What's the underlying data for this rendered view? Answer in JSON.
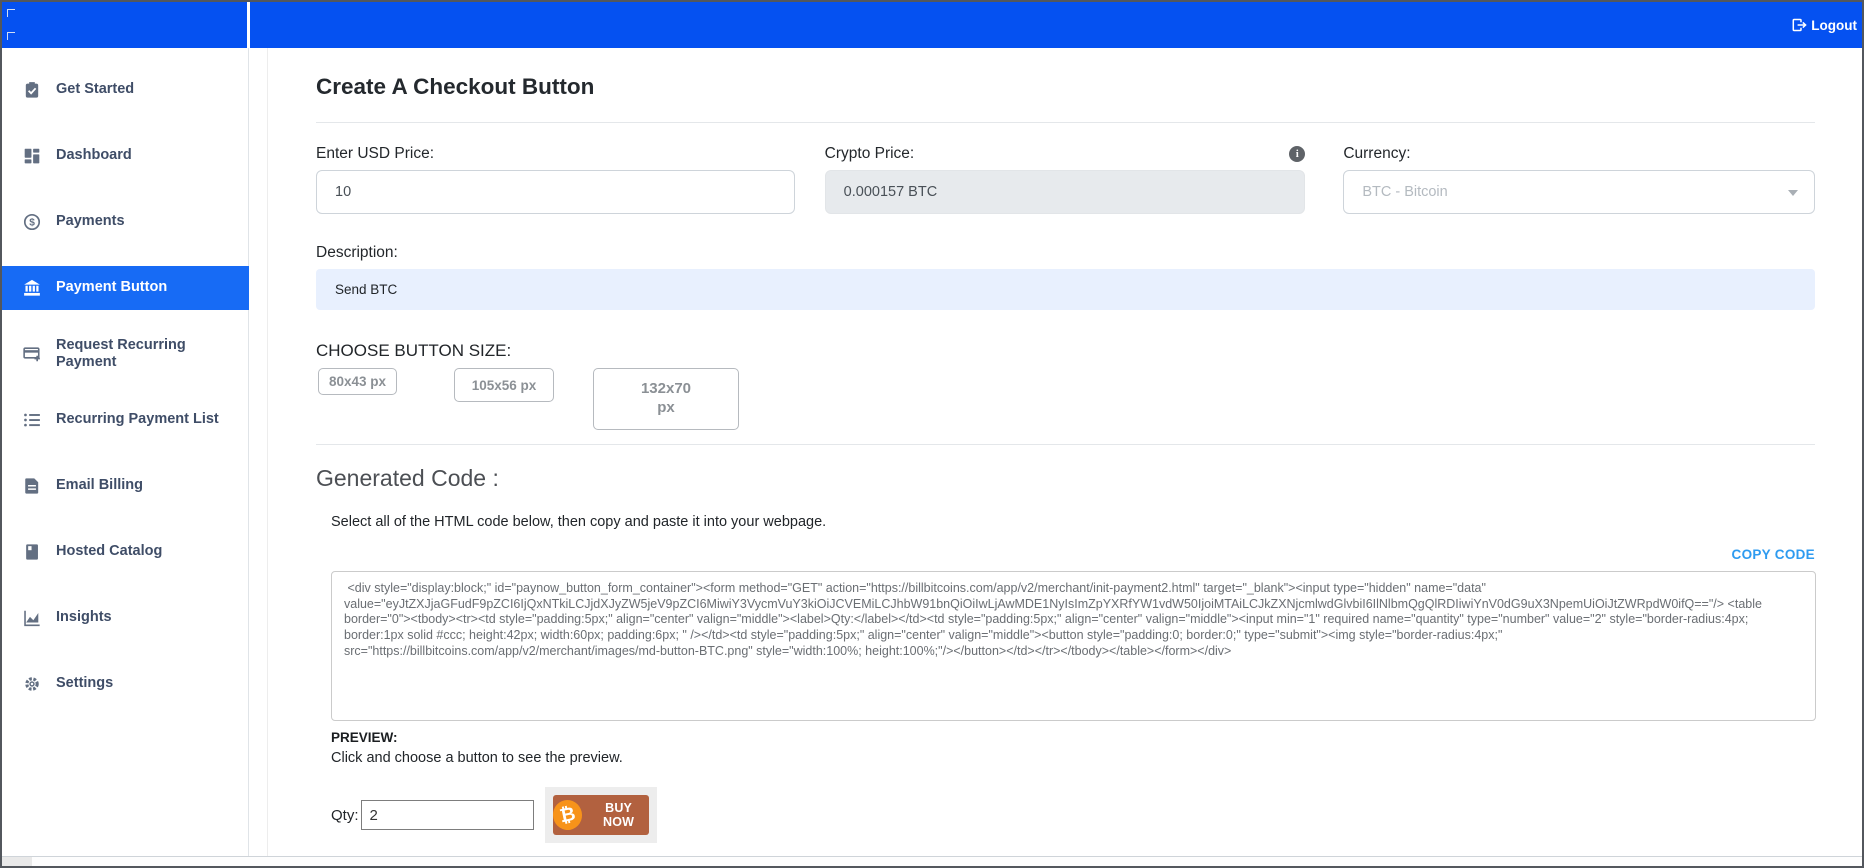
{
  "topbar": {
    "logout_label": "Logout"
  },
  "sidebar": {
    "items": [
      {
        "icon": "clipboard-check",
        "label": "Get Started"
      },
      {
        "icon": "dashboard-grid",
        "label": "Dashboard"
      },
      {
        "icon": "dollar-circle",
        "label": "Payments"
      },
      {
        "icon": "bank",
        "label": "Payment Button",
        "active": true
      },
      {
        "icon": "card-plus",
        "label": "Request Recurring Payment"
      },
      {
        "icon": "list",
        "label": "Recurring Payment List"
      },
      {
        "icon": "document",
        "label": "Email Billing"
      },
      {
        "icon": "book",
        "label": "Hosted Catalog"
      },
      {
        "icon": "chart-line",
        "label": "Insights"
      },
      {
        "icon": "gear",
        "label": "Settings"
      }
    ]
  },
  "page": {
    "title": "Create A Checkout Button"
  },
  "form": {
    "usd_price": {
      "label": "Enter USD Price:",
      "value": "10"
    },
    "crypto_price": {
      "label": "Crypto Price:",
      "value": "0.000157 BTC"
    },
    "currency": {
      "label": "Currency:",
      "value": "BTC - Bitcoin"
    },
    "description": {
      "label": "Description:",
      "value": "Send BTC"
    },
    "button_size": {
      "label": "CHOOSE BUTTON SIZE:",
      "options": [
        "80x43 px",
        "105x56 px",
        "132x70 px"
      ]
    }
  },
  "generated": {
    "heading": "Generated Code :",
    "instructions": "Select all of the HTML code below, then copy and paste it into your webpage.",
    "copy_label": "COPY CODE",
    "code": " <div style=\"display:block;\" id=\"paynow_button_form_container\"><form method=\"GET\" action=\"https://billbitcoins.com/app/v2/merchant/init-payment2.html\" target=\"_blank\"><input type=\"hidden\" name=\"data\" value=\"eyJtZXJjaGFudF9pZCI6IjQxNTkiLCJjdXJyZW5jeV9pZCI6MiwiY3VycmVuY3kiOiJCVEMiLCJhbW91bnQiOiIwLjAwMDE1NyIsImZpYXRfYW1vdW50IjoiMTAiLCJkZXNjcmlwdGlvbiI6IlNlbmQgQlRDIiwiYnV0dG9uX3NpemUiOiJtZWRpdW0ifQ==\"/> <table border=\"0\"><tbody><tr><td style=\"padding:5px;\" align=\"center\" valign=\"middle\"><label>Qty:</label></td><td style=\"padding:5px;\" align=\"center\" valign=\"middle\"><input min=\"1\" required name=\"quantity\" type=\"number\" value=\"2\" style=\"border-radius:4px; border:1px solid #ccc; height:42px; width:60px; padding:6px; \" /></td><td style=\"padding:5px;\" align=\"center\" valign=\"middle\"><button style=\"padding:0; border:0;\" type=\"submit\"><img style=\"border-radius:4px;\" src=\"https://billbitcoins.com/app/v2/merchant/images/md-button-BTC.png\" style=\"width:100%; height:100%;\"/></button></td></tr></tbody></table></form></div>"
  },
  "preview": {
    "heading": "PREVIEW:",
    "instructions": "Click and choose a button to see the preview.",
    "qty_label": "Qty:",
    "qty_value": "2",
    "buy_label": "BUY NOW"
  },
  "icons": {
    "logout": "box-arrow-right",
    "info": "i",
    "currency_chevron": "chevron-down",
    "bitcoin": "₿"
  },
  "colors": {
    "topbar_blue": "#0551f1",
    "active_item_blue": "#176bf5",
    "description_bg": "#e8f0fe",
    "copy_link_blue": "#2e9bf0",
    "buy_button": "#b2613f",
    "bitcoin_orange": "#f7931a"
  }
}
